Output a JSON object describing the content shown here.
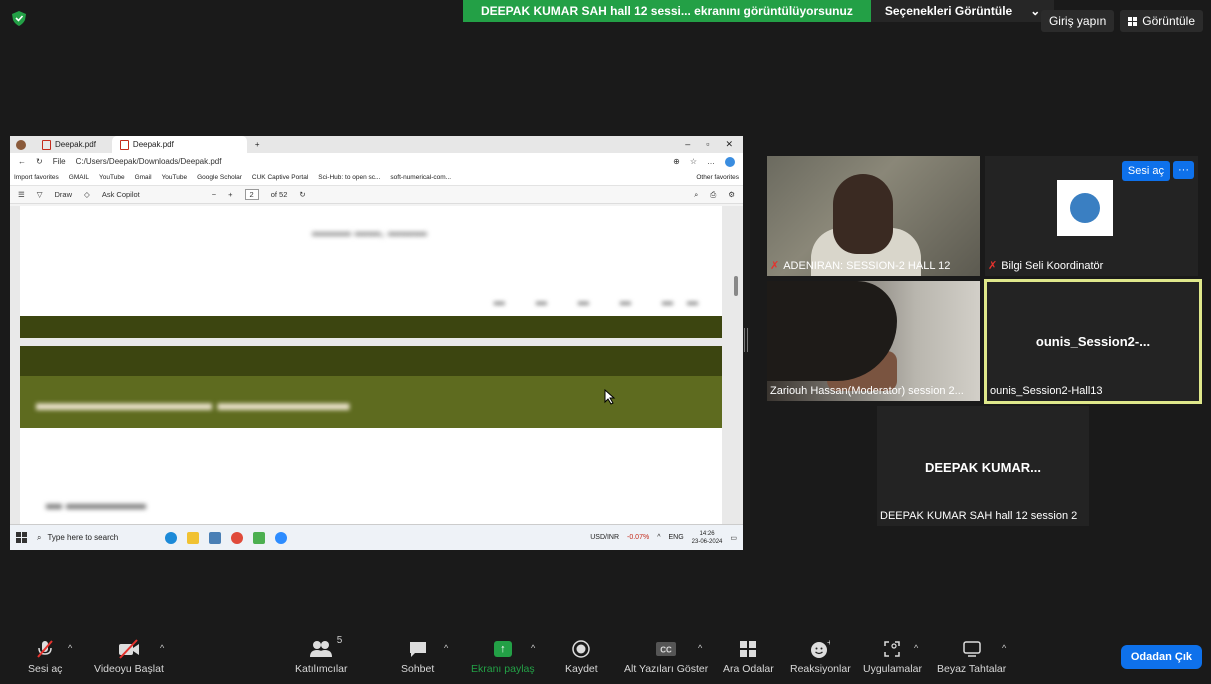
{
  "share_banner": {
    "message": "DEEPAK KUMAR SAH hall 12 sessi... ekranını görüntülüyorsunuz",
    "options": "Seçenekleri Görüntüle",
    "chevron": "⌄"
  },
  "top_right": {
    "login": "Giriş yapın",
    "view": "Görüntüle"
  },
  "shared_screen": {
    "tabs": [
      "Deepak.pdf",
      "Deepak.pdf"
    ],
    "url": "C:/Users/Deepak/Downloads/Deepak.pdf",
    "file_label": "File",
    "favorites": [
      "Import favorites",
      "GMAIL",
      "YouTube",
      "Gmail",
      "YouTube",
      "Google Scholar",
      "CUK Captive Portal",
      "Sci-Hub: to open sc...",
      "soft-numerical-com..."
    ],
    "other_favorites": "Other favorites",
    "pdf_toolbar": {
      "draw": "Draw",
      "ask": "Ask Copilot",
      "page": "2",
      "of_pages": "of 52"
    },
    "taskbar": {
      "search": "Type here to search",
      "ticker": "USD/INR",
      "ticker_change": "-0.07%",
      "lang": "ENG",
      "time": "14:26",
      "date": "23-06-2024"
    }
  },
  "participants": [
    {
      "name": "ADENIRAN: SESSION-2  HALL 12",
      "muted": true
    },
    {
      "name": "Bilgi Seli Koordinatör",
      "muted": true,
      "unmute_label": "Sesi aç",
      "more_label": "···"
    },
    {
      "name": "Zariouh Hassan(Moderator)  session 2...",
      "muted": false
    },
    {
      "name": "ounis_Session2-Hall13",
      "display": "ounis_Session2-...",
      "muted": false
    },
    {
      "name": "DEEPAK KUMAR SAH hall 12 session 2",
      "display": "DEEPAK  KUMAR...",
      "muted": false
    }
  ],
  "toolbar": {
    "unmute": "Sesi aç",
    "start_video": "Videoyu Başlat",
    "participants": "Katılımcılar",
    "participant_count": "5",
    "chat": "Sohbet",
    "share_screen": "Ekranı paylaş",
    "record": "Kaydet",
    "captions": "Alt Yazıları Göster",
    "breakout": "Ara Odalar",
    "reactions": "Reaksiyonlar",
    "apps": "Uygulamalar",
    "whiteboards": "Beyaz Tahtalar",
    "leave": "Odadan Çık"
  },
  "colors": {
    "share_green": "#23a046",
    "accent_blue": "#0e71eb",
    "active_speaker": "#dfe88b",
    "muted_red": "#e5322d"
  }
}
